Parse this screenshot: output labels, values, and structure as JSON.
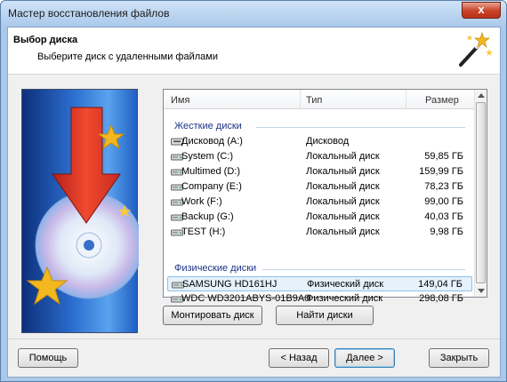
{
  "window": {
    "title": "Мастер восстановления файлов",
    "close_label": "x"
  },
  "header": {
    "title": "Выбор диска",
    "subtitle": "Выберите диск с удаленными файлами"
  },
  "list": {
    "columns": {
      "name": "Имя",
      "type": "Тип",
      "size": "Размер"
    },
    "groups": {
      "hard": "Жесткие диски",
      "physical": "Физические диски"
    },
    "hard_drives": [
      {
        "name": "Дисковод (A:)",
        "type": "Дисковод",
        "size": ""
      },
      {
        "name": "System (C:)",
        "type": "Локальный диск",
        "size": "59,85 ГБ"
      },
      {
        "name": "Multimed (D:)",
        "type": "Локальный диск",
        "size": "159,99 ГБ"
      },
      {
        "name": "Company (E:)",
        "type": "Локальный диск",
        "size": "78,23 ГБ"
      },
      {
        "name": "Work (F:)",
        "type": "Локальный диск",
        "size": "99,00 ГБ"
      },
      {
        "name": "Backup (G:)",
        "type": "Локальный диск",
        "size": "40,03 ГБ"
      },
      {
        "name": "TEST (H:)",
        "type": "Локальный диск",
        "size": "9,98 ГБ"
      }
    ],
    "physical_drives": [
      {
        "name": "SAMSUNG HD161HJ",
        "type": "Физический диск",
        "size": "149,04 ГБ"
      },
      {
        "name": "WDC WD3201ABYS-01B9A0",
        "type": "Физический диск",
        "size": "298,08 ГБ"
      }
    ],
    "selected_physical_index": 0
  },
  "buttons": {
    "mount": "Монтировать диск",
    "find": "Найти диски",
    "help": "Помощь",
    "back": "< Назад",
    "next": "Далее >",
    "close": "Закрыть"
  },
  "colors": {
    "group_text": "#1e3287",
    "selection": "#e5f1fb",
    "art_blue": "#2c6fd0",
    "arrow_red": "#e03a24",
    "star_gold": "#f3b81e"
  },
  "icons": {
    "close": "close-icon",
    "wizard": "magic-wand-icon",
    "drive": "hard-drive-icon",
    "floppy": "floppy-drive-icon"
  }
}
